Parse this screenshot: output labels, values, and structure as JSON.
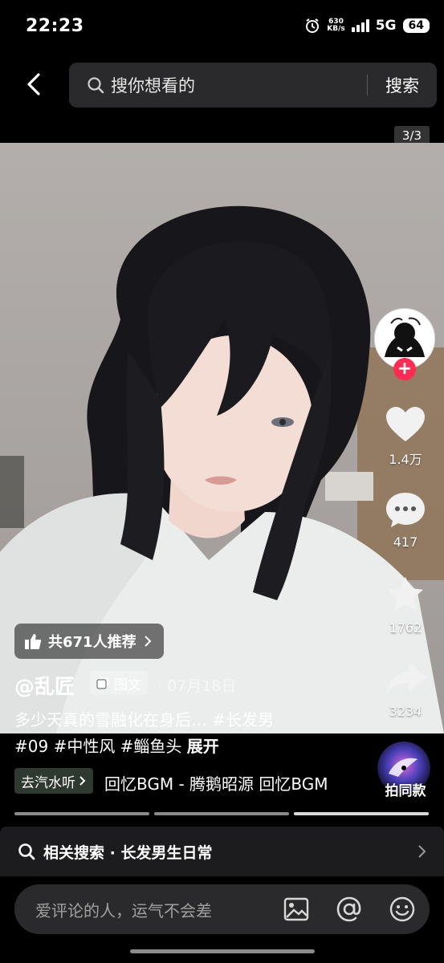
{
  "status_bar": {
    "time": "22:23",
    "net_speed_value": "630",
    "net_speed_unit": "KB/s",
    "network": "5G",
    "battery": "64"
  },
  "header": {
    "search_placeholder": "搜你想看的",
    "search_button": "搜索",
    "image_counter": "3/3"
  },
  "post": {
    "recommend_label": "共671人推荐",
    "author": "@乱匠",
    "type_tag": "图文",
    "date": "· 07月18日",
    "caption_line1": "多少天真的雪融化在身后… #长发男",
    "caption_line2": "#09 #中性风 #鲻鱼头",
    "expand_label": "展开"
  },
  "actions": {
    "likes": "1.4万",
    "comments": "417",
    "favorites": "1762",
    "shares": "3234"
  },
  "music": {
    "tag_label": "去汽水听",
    "track_text": "回忆BGM - 腾鹅昭源    回忆BGM",
    "use_sound_label": "拍同款"
  },
  "related_search": {
    "label": "相关搜索 · 长发男生日常"
  },
  "comment_bar": {
    "placeholder": "爱评论的人，运气不会差"
  },
  "colors": {
    "accent": "#fe2c55",
    "background": "#000000",
    "panel": "#1c1c1e",
    "input_bg": "#2a2a2c"
  }
}
